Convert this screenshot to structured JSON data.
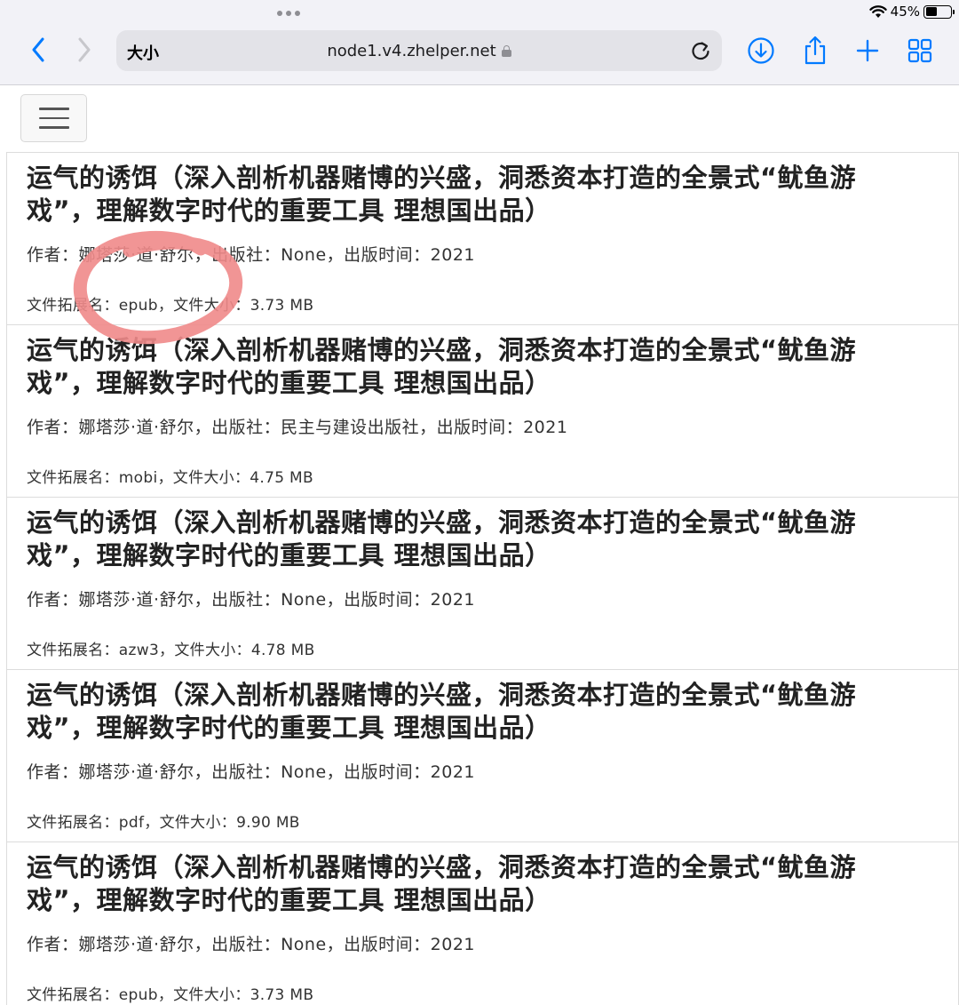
{
  "status_bar": {
    "battery": "45%",
    "battery_level": 0.45
  },
  "browser": {
    "text_size_label": "大小",
    "url": "node1.v4.zhelper.net",
    "icons": {
      "back": "chevron-left-icon",
      "forward": "chevron-right-icon",
      "reload": "reload-icon",
      "download": "download-icon",
      "share": "share-icon",
      "new_tab": "plus-icon",
      "tabs": "tabs-grid-icon"
    },
    "accent_color": "#007aff"
  },
  "menu_icon": "hamburger-menu-icon",
  "results": [
    {
      "title": "运气的诱饵（深入剖析机器赌博的兴盛，洞悉资本打造的全景式“鱿鱼游戏”，理解数字时代的重要工具 理想国出品）",
      "meta": "作者：娜塔莎·道·舒尔，出版社：None，出版时间：2021",
      "file": "文件拓展名：epub，文件大小：3.73 MB"
    },
    {
      "title": "运气的诱饵（深入剖析机器赌博的兴盛，洞悉资本打造的全景式“鱿鱼游戏”，理解数字时代的重要工具 理想国出品）",
      "meta": "作者：娜塔莎·道·舒尔，出版社：民主与建设出版社，出版时间：2021",
      "file": "文件拓展名：mobi，文件大小：4.75 MB"
    },
    {
      "title": "运气的诱饵（深入剖析机器赌博的兴盛，洞悉资本打造的全景式“鱿鱼游戏”，理解数字时代的重要工具 理想国出品）",
      "meta": "作者：娜塔莎·道·舒尔，出版社：None，出版时间：2021",
      "file": "文件拓展名：azw3，文件大小：4.78 MB"
    },
    {
      "title": "运气的诱饵（深入剖析机器赌博的兴盛，洞悉资本打造的全景式“鱿鱼游戏”，理解数字时代的重要工具 理想国出品）",
      "meta": "作者：娜塔莎·道·舒尔，出版社：None，出版时间：2021",
      "file": "文件拓展名：pdf，文件大小：9.90 MB"
    },
    {
      "title": "运气的诱饵（深入剖析机器赌博的兴盛，洞悉资本打造的全景式“鱿鱼游戏”，理解数字时代的重要工具 理想国出品）",
      "meta": "作者：娜塔莎·道·舒尔，出版社：None，出版时间：2021",
      "file": "文件拓展名：epub，文件大小：3.73 MB"
    }
  ],
  "annotation_color": "#f08a8a"
}
